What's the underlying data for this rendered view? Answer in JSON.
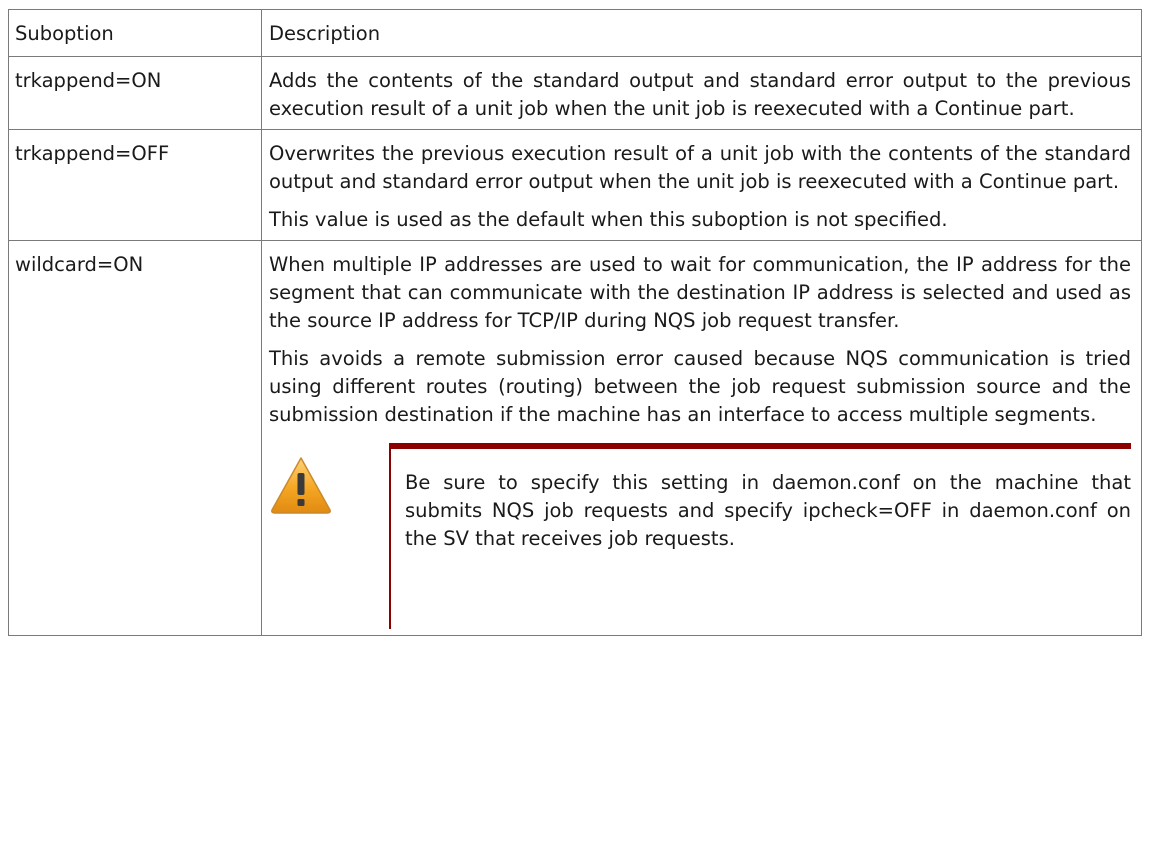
{
  "table": {
    "header": {
      "suboption": "Suboption",
      "description": "Description"
    },
    "rows": [
      {
        "suboption": "trkappend=ON",
        "paragraphs": [
          "Adds the contents of the standard output and standard error output to the previous execution result of a unit job when the unit job is reexecuted with a Continue part."
        ]
      },
      {
        "suboption": "trkappend=OFF",
        "paragraphs": [
          "Overwrites the previous execution result of a unit job with the contents of the standard output and standard error output when the unit job is reexecuted with a Continue part.",
          "This value is used as the default when this suboption is not specified."
        ]
      },
      {
        "suboption": "wildcard=ON",
        "paragraphs": [
          "When multiple IP addresses are used to wait for communication, the IP address for the segment that can communicate with the destination IP address is selected and used as the source IP address for TCP/IP during NQS job request transfer.",
          "This avoids a remote submission error caused because NQS communication is tried using different routes (routing) between the job request submission source and the submission destination if the machine has an interface to access multiple segments."
        ],
        "notice": {
          "icon": "warning-icon",
          "text": "Be sure to specify this setting in daemon.conf on the machine that submits NQS job requests and specify ipcheck=OFF in daemon.conf on the SV that receives job requests."
        }
      }
    ]
  },
  "colors": {
    "border": "#7a7a7a",
    "notice_accent": "#8b0000",
    "warning_fill": "#f5a623"
  }
}
